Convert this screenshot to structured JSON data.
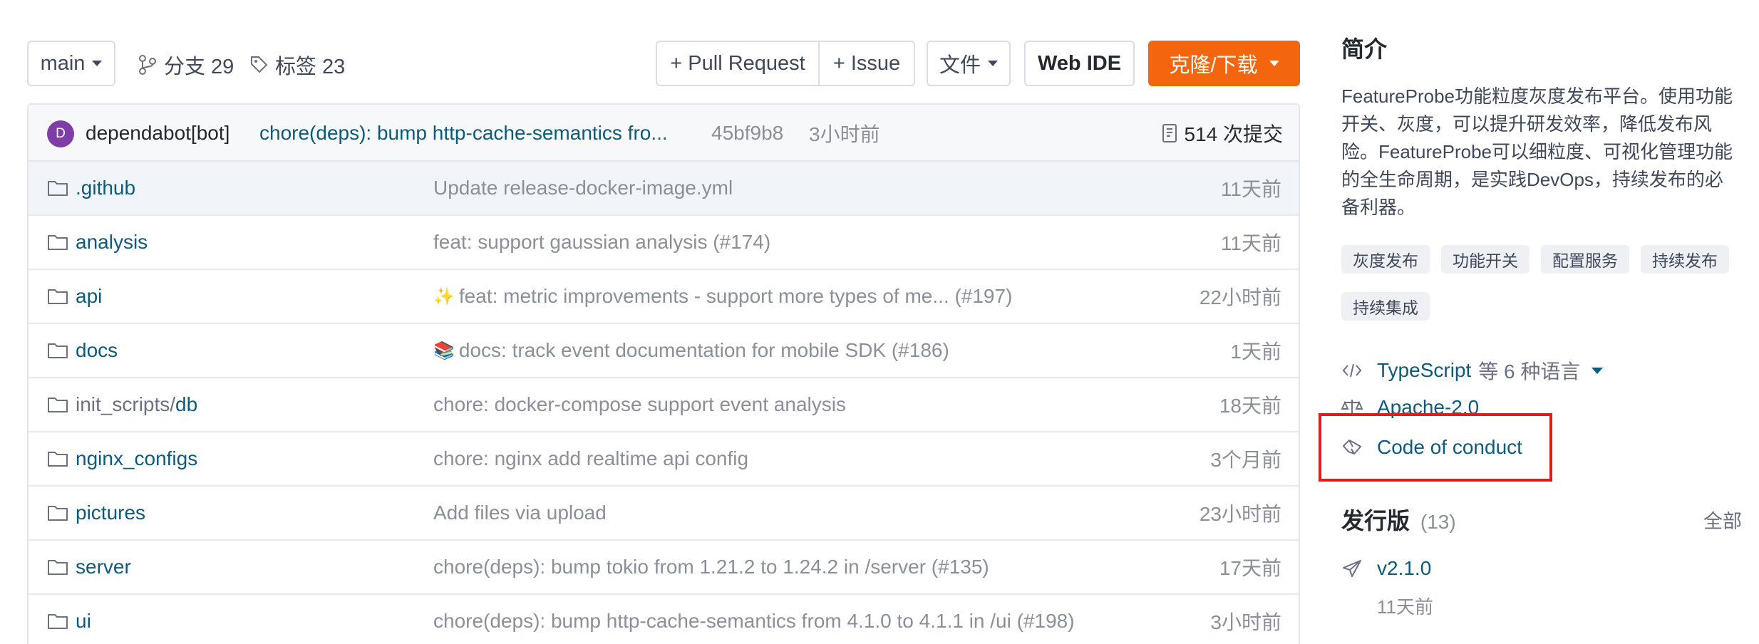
{
  "toolbar": {
    "branch": "main",
    "branches_label": "分支 29",
    "tags_label": "标签 23",
    "pull_request": "+ Pull Request",
    "issue": "+ Issue",
    "files": "文件",
    "web_ide": "Web IDE",
    "clone": "克隆/下载"
  },
  "commit": {
    "avatar_letter": "D",
    "author": "dependabot[bot]",
    "message": "chore(deps): bump http-cache-semantics fro...",
    "sha": "45bf9b8",
    "time": "3小时前",
    "count_label": "514 次提交"
  },
  "files": [
    {
      "prefix": "",
      "name": ".github",
      "message": "Update release-docker-image.yml",
      "emoji": "",
      "time": "11天前"
    },
    {
      "prefix": "",
      "name": "analysis",
      "message": "feat: support gaussian analysis (#174)",
      "emoji": "",
      "time": "11天前"
    },
    {
      "prefix": "",
      "name": "api",
      "message": "feat: metric improvements - support more types of me... (#197)",
      "emoji": "✨",
      "time": "22小时前"
    },
    {
      "prefix": "",
      "name": "docs",
      "message": "docs: track event documentation for mobile SDK (#186)",
      "emoji": "📚",
      "time": "1天前"
    },
    {
      "prefix": "init_scripts/",
      "name": "db",
      "message": "chore: docker-compose support event analysis",
      "emoji": "",
      "time": "18天前"
    },
    {
      "prefix": "",
      "name": "nginx_configs",
      "message": "chore: nginx add realtime api config",
      "emoji": "",
      "time": "3个月前"
    },
    {
      "prefix": "",
      "name": "pictures",
      "message": "Add files via upload",
      "emoji": "",
      "time": "23小时前"
    },
    {
      "prefix": "",
      "name": "server",
      "message": "chore(deps): bump tokio from 1.21.2 to 1.24.2 in /server (#135)",
      "emoji": "",
      "time": "17天前"
    },
    {
      "prefix": "",
      "name": "ui",
      "message": "chore(deps): bump http-cache-semantics from 4.1.0 to 4.1.1 in /ui (#198)",
      "emoji": "",
      "time": "3小时前"
    }
  ],
  "sidebar": {
    "intro_title": "简介",
    "description": "FeatureProbe功能粒度灰度发布平台。使用功能开关、灰度，可以提升研发效率，降低发布风险。FeatureProbe可以细粒度、可视化管理功能的全生命周期，是实践DevOps，持续发布的必备利器。",
    "tags": [
      "灰度发布",
      "功能开关",
      "配置服务",
      "持续发布",
      "持续集成"
    ],
    "language": "TypeScript",
    "language_more": "等 6 种语言",
    "license": "Apache-2.0",
    "code_of_conduct": "Code of conduct",
    "releases_title": "发行版",
    "releases_count": "(13)",
    "releases_all": "全部",
    "release_version": "v2.1.0",
    "release_time": "11天前"
  },
  "colors": {
    "accent_orange": "#f4660d",
    "link": "#0d5b7c",
    "highlight_box": "#e21b1b",
    "avatar": "#7f3ea7"
  }
}
